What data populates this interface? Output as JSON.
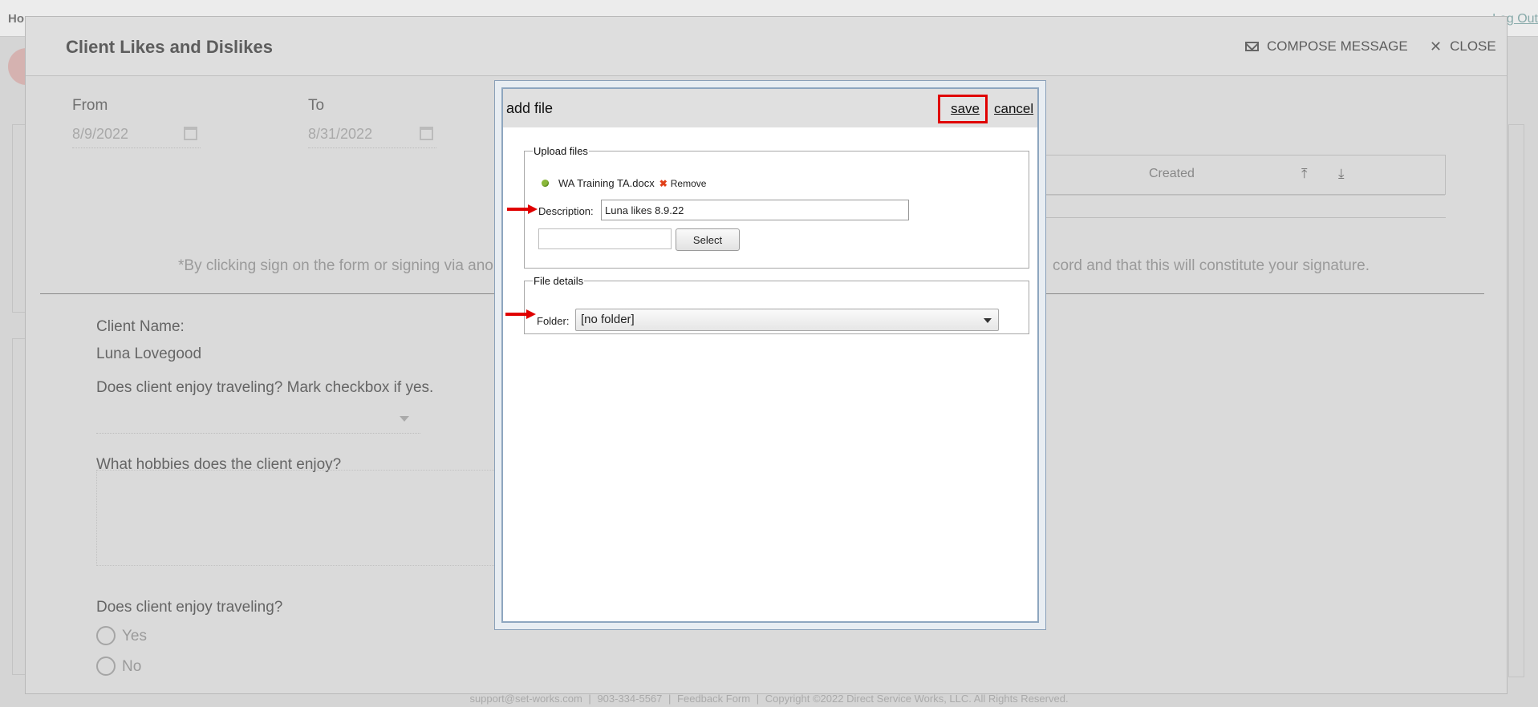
{
  "background": {
    "home_label": "Ho",
    "logout_label": "Log Out",
    "footer": [
      "support@set-works.com",
      "|",
      "903-334-5567",
      "|",
      "Feedback Form",
      "|",
      "Copyright ©2022 Direct Service Works, LLC. All Rights Reserved."
    ]
  },
  "modal": {
    "title": "Client Likes and Dislikes",
    "compose_label": "COMPOSE MESSAGE",
    "close_label": "CLOSE",
    "from_label": "From",
    "from_value": "8/9/2022",
    "to_label": "To",
    "to_value": "8/31/2022",
    "grid_created_header": "Created",
    "sign_note_part1": "*By clicking sign on the form or signing via ano",
    "sign_note_part2": "cord and that this will constitute your signature.",
    "form": {
      "client_name_label": "Client Name:",
      "client_name_value": "Luna Lovegood",
      "q_travel_checkbox": "Does client enjoy traveling? Mark checkbox if yes.",
      "q_hobbies": "What hobbies does the client enjoy?",
      "q_travel": "Does client enjoy traveling?",
      "opt_yes": "Yes",
      "opt_no": "No"
    }
  },
  "dialog": {
    "title": "add file",
    "save_label": "save",
    "cancel_label": "cancel",
    "upload_legend": "Upload files",
    "file_name": "WA Training TA.docx",
    "remove_label": "Remove",
    "description_label": "Description:",
    "description_value": "Luna likes 8.9.22",
    "select_button": "Select",
    "details_legend": "File details",
    "folder_label": "Folder:",
    "folder_value": "[no folder]"
  },
  "colors": {
    "highlight": "#e00000",
    "status_dot": "#8ab83a",
    "remove_x": "#e0401a"
  }
}
